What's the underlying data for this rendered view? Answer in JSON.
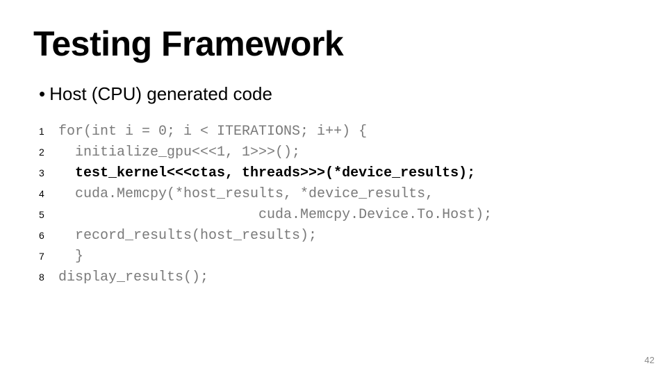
{
  "title": "Testing Framework",
  "bullet": "Host (CPU) generated code",
  "code": {
    "lines": [
      {
        "n": "1",
        "text": "for(int i = 0; i < ITERATIONS; i++) {",
        "bold": false
      },
      {
        "n": "2",
        "text": "  initialize_gpu<<<1, 1>>>();",
        "bold": false
      },
      {
        "n": "3",
        "text": "  test_kernel<<<ctas, threads>>>(*device_results);",
        "bold": true
      },
      {
        "n": "4",
        "text": "  cuda.Memcpy(*host_results, *device_results,",
        "bold": false
      },
      {
        "n": "5",
        "text": "                        cuda.Memcpy.Device.To.Host);",
        "bold": false
      },
      {
        "n": "6",
        "text": "  record_results(host_results);",
        "bold": false
      },
      {
        "n": "7",
        "text": "  }",
        "bold": false
      },
      {
        "n": "8",
        "text": "display_results();",
        "bold": false
      }
    ]
  },
  "page_number": "42"
}
